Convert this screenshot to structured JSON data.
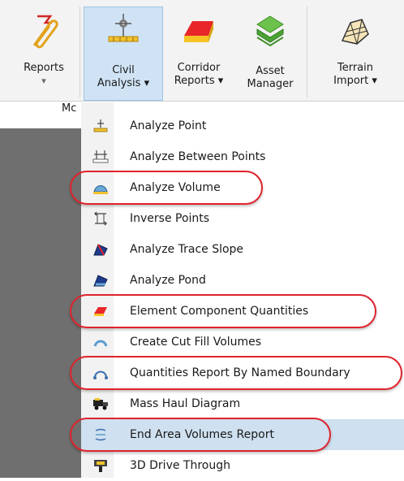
{
  "ribbon": {
    "buttons": [
      {
        "label": "Reports",
        "arrow": "▾",
        "icon": "paperclip-report-icon"
      },
      {
        "label": "Civil",
        "label2": "Analysis ▾",
        "icon": "civil-analysis-icon"
      },
      {
        "label": "Corridor",
        "label2": "Reports ▾",
        "icon": "corridor-reports-icon"
      },
      {
        "label": "Asset",
        "label2": "Manager",
        "icon": "asset-manager-icon"
      },
      {
        "label": "Terrain",
        "label2": "Import ▾",
        "icon": "terrain-import-icon"
      }
    ],
    "group_label": "Mc"
  },
  "menu": {
    "items": [
      {
        "label": "Analyze Point",
        "icon": "analyze-point-icon"
      },
      {
        "label": "Analyze Between Points",
        "icon": "analyze-between-points-icon"
      },
      {
        "label": "Analyze Volume",
        "icon": "analyze-volume-icon",
        "circled": true
      },
      {
        "label": "Inverse Points",
        "icon": "inverse-points-icon"
      },
      {
        "label": "Analyze Trace Slope",
        "icon": "analyze-trace-slope-icon"
      },
      {
        "label": "Analyze Pond",
        "icon": "analyze-pond-icon"
      },
      {
        "label": "Element Component Quantities",
        "icon": "element-component-quantities-icon",
        "circled": true
      },
      {
        "label": "Create Cut Fill Volumes",
        "icon": "cut-fill-volumes-icon"
      },
      {
        "label": "Quantities Report By Named Boundary",
        "icon": "named-boundary-icon",
        "circled": true
      },
      {
        "label": "Mass Haul Diagram",
        "icon": "mass-haul-icon"
      },
      {
        "label": "End Area Volumes Report",
        "icon": "end-area-volumes-icon",
        "circled": true,
        "selected": true
      },
      {
        "label": "3D Drive Through",
        "icon": "drive-through-icon"
      }
    ]
  },
  "colors": {
    "highlight": "#e0232c",
    "selected_row": "#cfe0f0",
    "active_button": "#cfe3f5"
  }
}
